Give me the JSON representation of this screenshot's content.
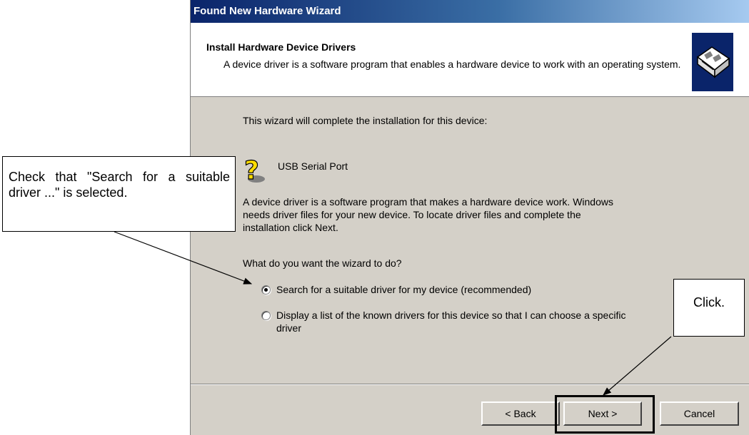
{
  "dialog": {
    "title": "Found New Hardware Wizard",
    "header_title": "Install Hardware Device Drivers",
    "header_desc": "A device driver is a software program that enables a hardware device to work with an operating system."
  },
  "content": {
    "intro": "This wizard will complete the installation for this device:",
    "device_name": "USB Serial Port",
    "desc_line1": "A device driver is a software program that makes a hardware device work. Windows",
    "desc_line2": "needs driver files for your new device. To locate driver files and complete the",
    "desc_line3": "installation click Next.",
    "question": "What do you want the wizard to do?",
    "option1": "Search for a suitable driver for my device (recommended)",
    "option2_line1": "Display a list of the known drivers for this device so that I can choose a specific",
    "option2_line2": "driver",
    "selected_option": "option1"
  },
  "buttons": {
    "back": "< Back",
    "next": "Next >",
    "cancel": "Cancel"
  },
  "annotations": {
    "left_callout": "Check that \"Search for a suitable driver ...\" is selected.",
    "right_callout": "Click."
  },
  "icons": {
    "header_icon": "hardware-card-icon",
    "device_icon": "question-mark-icon"
  },
  "colors": {
    "title_gradient_start": "#0a246a",
    "title_gradient_end": "#a6caf0",
    "dialog_face": "#d4d0c8"
  }
}
